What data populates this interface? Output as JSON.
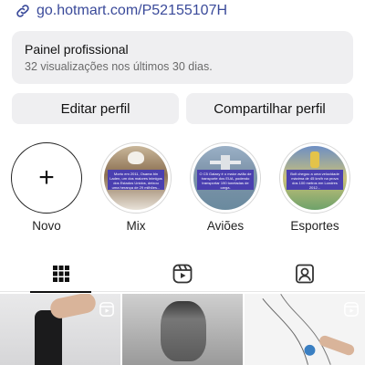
{
  "profile": {
    "link": "go.hotmart.com/P52155107H",
    "link_icon": "link-icon"
  },
  "panel": {
    "title": "Painel profissional",
    "subtitle": "32 visualizações nos últimos 30 dias."
  },
  "buttons": {
    "edit": "Editar perfil",
    "share": "Compartilhar perfil"
  },
  "highlights": [
    {
      "label": "Novo",
      "caption": ""
    },
    {
      "label": "Mix",
      "caption": "Morto em 2011, Osama bin Laden, um dos maiores inimigos dos Estados Unidos, deixou uma herança de 29 milhões..."
    },
    {
      "label": "Aviões",
      "caption": "O C5 Galaxy é o maior avião de transporte dos EUA, podendo transportar 190 toneladas de carga."
    },
    {
      "label": "Esportes",
      "caption": "Bolt chegou a uma velocidade máxima de 45 km/h na prova dos 100 metros em Londres 2012..."
    }
  ],
  "tabs": [
    {
      "name": "grid-icon",
      "active": true
    },
    {
      "name": "reels-icon",
      "active": false
    },
    {
      "name": "tagged-icon",
      "active": false
    }
  ],
  "colors": {
    "link": "#3a4a9a",
    "panel_bg": "#efeff1",
    "caption_bg": "#4a3fb0"
  }
}
